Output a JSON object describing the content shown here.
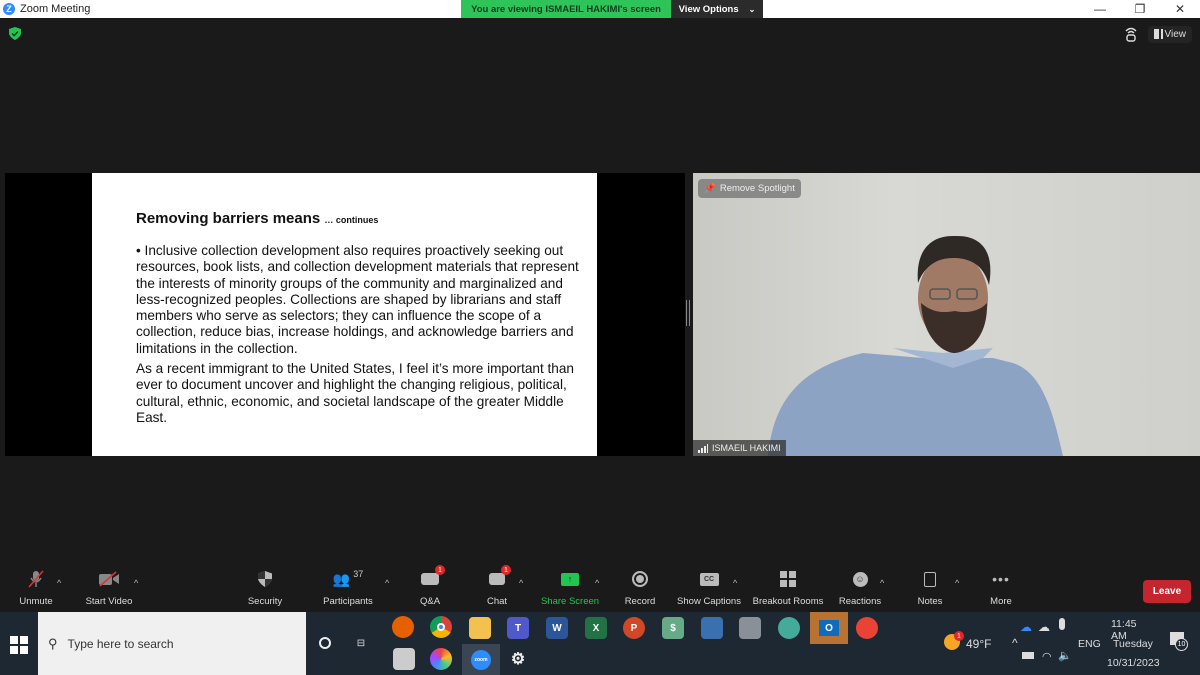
{
  "window": {
    "title": "Zoom Meeting",
    "banner_text": "You are viewing ISMAEIL HAKIMI's screen",
    "view_options_label": "View Options",
    "view_label": "View"
  },
  "slide": {
    "title": "Removing barriers means",
    "title_suffix": "… continues",
    "bullet": "• Inclusive collection development also requires proactively seeking out resources, book lists, and collection development materials that represent the interests of minority groups of the community and marginalized and less-recognized peoples. Collections are shaped by librarians and staff members who serve as selectors; they can influence the scope of a collection, reduce bias, increase holdings, and acknowledge barriers and limitations in the collection.",
    "paragraph": "As a recent immigrant to the United States, I feel it’s more important than ever to document uncover and highlight the changing religious, political, cultural, ethnic, economic, and societal landscape of the greater Middle East."
  },
  "video": {
    "remove_spotlight_label": "Remove Spotlight",
    "participant_name": "ISMAEIL HAKIMI"
  },
  "toolbar": {
    "unmute": "Unmute",
    "start_video": "Start Video",
    "security": "Security",
    "participants": "Participants",
    "participants_count": "37",
    "qa": "Q&A",
    "qa_badge": "1",
    "chat": "Chat",
    "chat_badge": "1",
    "share_screen": "Share Screen",
    "record": "Record",
    "show_captions": "Show Captions",
    "cc": "CC",
    "breakout_rooms": "Breakout Rooms",
    "reactions": "Reactions",
    "notes": "Notes",
    "more": "More",
    "leave": "Leave"
  },
  "taskbar": {
    "search_placeholder": "Type here to search",
    "weather_temp": "49°F",
    "weather_badge": "1",
    "language": "ENG",
    "time": "11:45 AM",
    "day": "Tuesday",
    "date": "10/31/2023",
    "notifications_count": "10",
    "zoom_app_label": "zoom"
  },
  "colors": {
    "banner_green": "#2ec459",
    "share_green": "#23c552",
    "leave_red": "#c4252f",
    "badge_red": "#e02828"
  }
}
